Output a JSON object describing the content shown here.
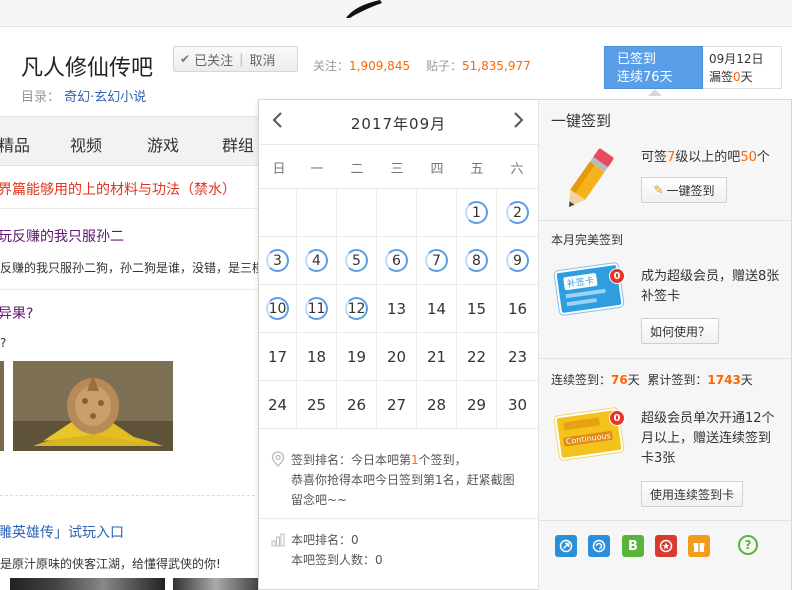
{
  "forum": {
    "name": "凡人修仙传吧",
    "follow": {
      "followed_label": "已关注",
      "unfollow_label": "取消"
    },
    "stats": {
      "follow_label": "关注：",
      "follow_count": "1,909,845",
      "posts_label": "贴子：",
      "posts_count": "51,835,977"
    },
    "catalog_label": "目录：",
    "catalog_value": "奇幻·玄幻小说"
  },
  "sign": {
    "status": "已签到",
    "streak": "连续76天",
    "date": "09月12日",
    "missed_prefix": "漏签",
    "missed_count": "0",
    "missed_suffix": "天"
  },
  "nav": {
    "items": [
      "精品",
      "视频",
      "游戏",
      "群组"
    ]
  },
  "posts": [
    {
      "title": "界篇能够用的上的材料与功法（禁水）"
    },
    {
      "title": "玩反赚的我只服孙二",
      "excerpt": "反赚的我只服孙二狗，孙二狗是谁，没错，是三楼"
    },
    {
      "title": "异果?",
      "excerpt": "?"
    },
    {
      "title": "雕英雄传」试玩入口",
      "excerpt": "是原汁原味的侠客江湖，给懂得武侠的你!"
    }
  ],
  "calendar": {
    "month_title": "2017年09月",
    "weekdays": [
      "日",
      "一",
      "二",
      "三",
      "四",
      "五",
      "六"
    ],
    "first_weekday": 5,
    "days_in_month": 30,
    "signed_days": [
      1,
      2,
      3,
      4,
      5,
      6,
      7,
      8,
      9,
      10,
      11,
      12
    ],
    "rank": {
      "line1_prefix": "签到排名：今日本吧第",
      "line1_rank": "1",
      "line1_suffix": "个签到，",
      "line2": "恭喜你抢得本吧今日签到第1名，赶紧截图",
      "line3": "留念吧~~"
    },
    "bar_rank": "本吧排名：0",
    "bar_count": "本吧签到人数：0"
  },
  "side": {
    "title": "一键签到",
    "onekey_text_prefix": "可签",
    "onekey_level": "7",
    "onekey_text_mid": "级以上的吧",
    "onekey_count": "50",
    "onekey_text_suffix": "个",
    "onekey_button": "一键签到",
    "perfect_title": "本月完美签到",
    "perfect_text": "成为超级会员，赠送8张补签卡",
    "perfect_button": "如何使用？",
    "streak_label": "连续签到：",
    "streak_value": "76",
    "streak_unit": "天",
    "total_label": "累计签到：",
    "total_value": "1743",
    "total_unit": "天",
    "continuous_text": "超级会员单次开通12个月以上，赠送连续签到卡3张",
    "continuous_button": "使用连续签到卡",
    "card_badge": "0",
    "card1_label": "补签卡",
    "card2_label": "Continuous",
    "help_icon": "?"
  },
  "colors": {
    "accent_blue": "#5a9ee8",
    "orange": "#ff6600",
    "red_title": "#e0341e"
  }
}
